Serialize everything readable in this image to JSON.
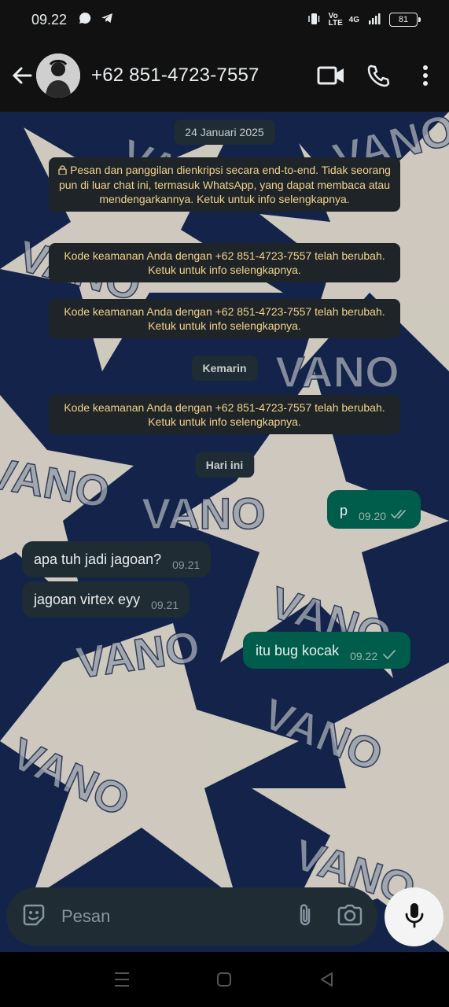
{
  "status_bar": {
    "time": "09.22",
    "network": "4G",
    "volte": "Vo LTE",
    "battery": "81",
    "icons": [
      "whatsapp-icon",
      "telegram-icon",
      "vibrate-icon",
      "signal-icon"
    ]
  },
  "header": {
    "contact": "+62 851-4723-7557",
    "icons": [
      "back-arrow-icon",
      "video-call-icon",
      "voice-call-icon",
      "more-options-icon"
    ]
  },
  "chat": {
    "date_pills": {
      "first": "24 Januari 2025",
      "second": "Kemarin",
      "third": "Hari ini"
    },
    "system_messages": {
      "encryption": "Pesan dan panggilan dienkripsi secara end-to-end. Tidak seorang pun di luar chat ini, termasuk WhatsApp, yang dapat membaca atau mendengarkannya. Ketuk untuk info selengkapnya.",
      "security_1": "Kode keamanan Anda dengan +62 851-4723-7557 telah berubah. Ketuk untuk info selengkapnya.",
      "security_2": "Kode keamanan Anda dengan +62 851-4723-7557 telah berubah. Ketuk untuk info selengkapnya.",
      "security_3": "Kode keamanan Anda dengan +62 851-4723-7557 telah berubah. Ketuk untuk info selengkapnya."
    },
    "messages": [
      {
        "direction": "out",
        "text": "p",
        "time": "09.20",
        "status": "double-check"
      },
      {
        "direction": "in",
        "text": "apa tuh jadi jagoan?",
        "time": "09.21"
      },
      {
        "direction": "in",
        "text": "jagoan virtex eyy",
        "time": "09.21"
      },
      {
        "direction": "out",
        "text": "itu bug kocak",
        "time": "09.22",
        "status": "single-check"
      }
    ],
    "wallpaper_text": "VANO"
  },
  "composer": {
    "placeholder": "Pesan",
    "icons": [
      "sticker-icon",
      "attach-icon",
      "camera-icon",
      "mic-icon"
    ]
  },
  "nav_bar": {
    "icons": [
      "recent-apps-icon",
      "home-icon",
      "back-icon"
    ]
  },
  "colors": {
    "chat_bg": "#13234a",
    "outgoing_bubble": "#005c4b",
    "incoming_bubble": "#1f2c34",
    "system_text": "#f1d38c"
  }
}
